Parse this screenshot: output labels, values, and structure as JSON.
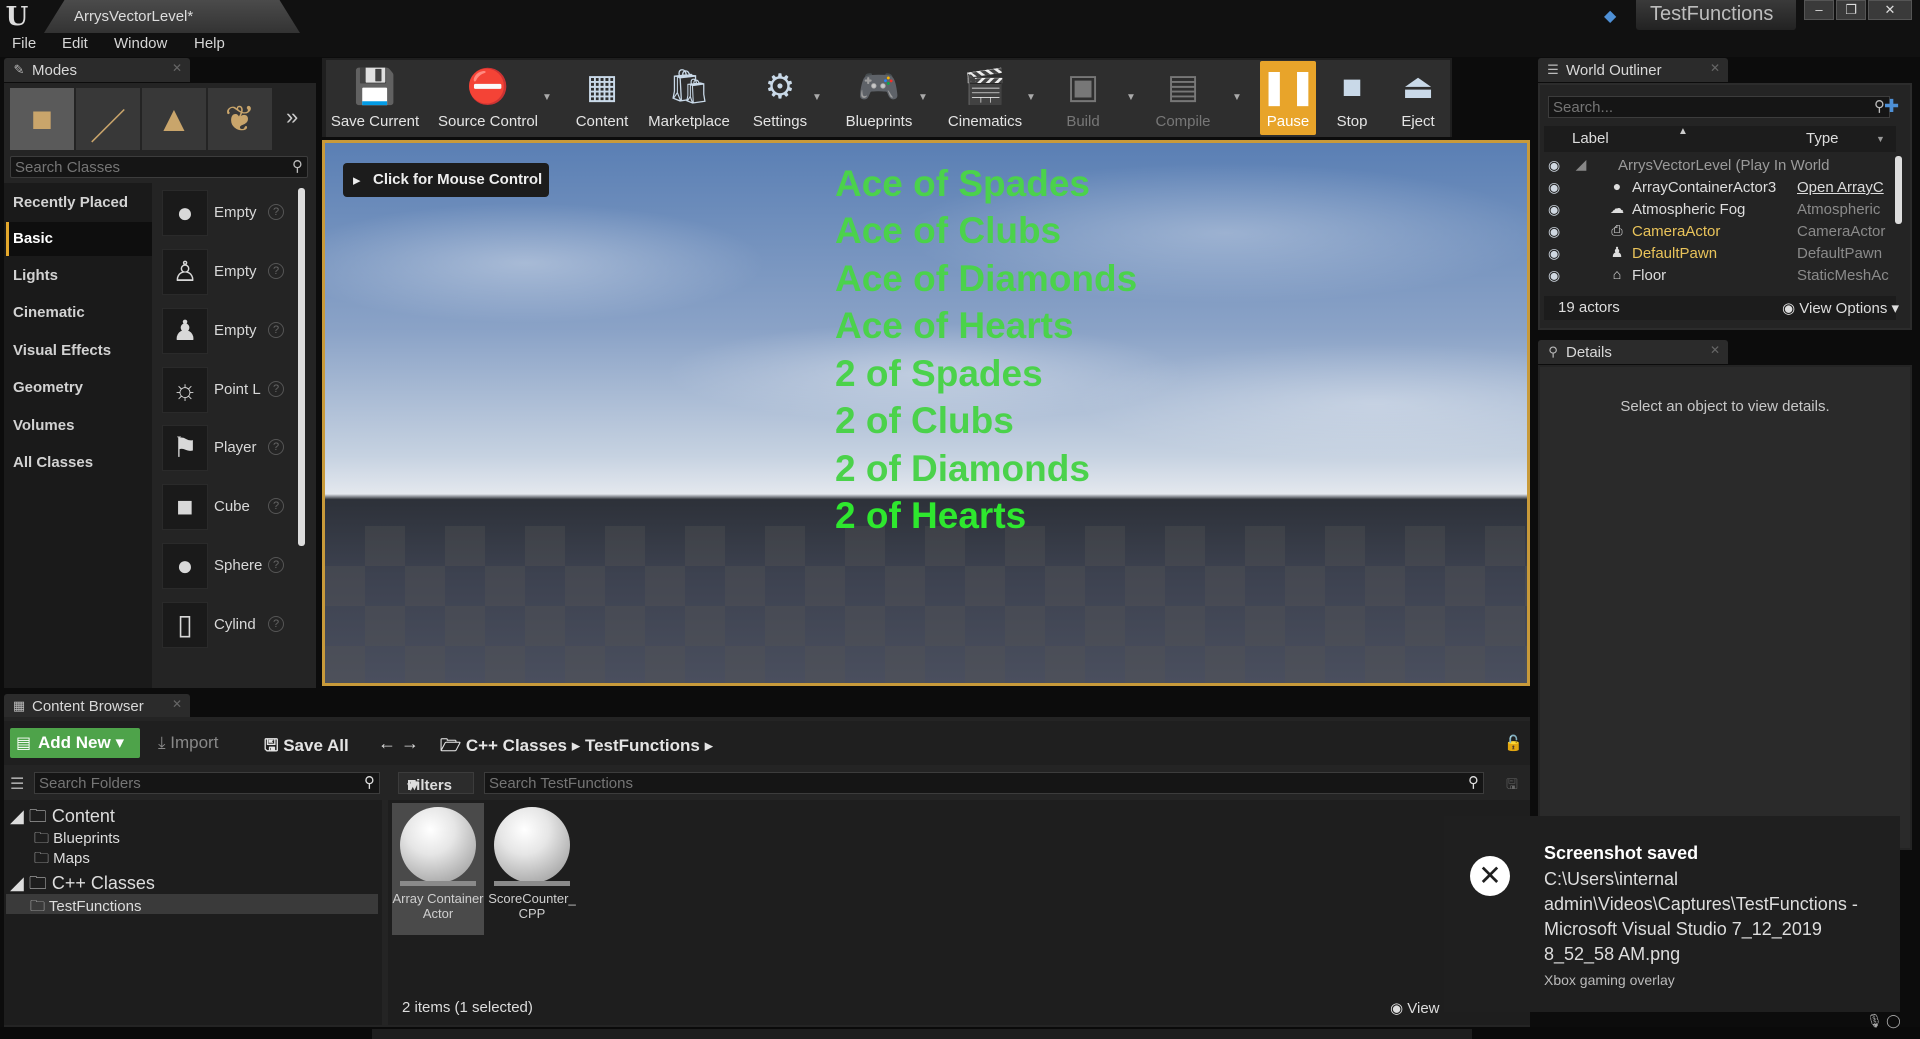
{
  "window": {
    "doc_tab": "ArrysVectorLevel*",
    "project_tab": "TestFunctions",
    "minimize": "–",
    "maximize": "❐",
    "close": "✕"
  },
  "menu": [
    "File",
    "Edit",
    "Window",
    "Help"
  ],
  "modes": {
    "tab_label": "Modes",
    "search_placeholder": "Search Classes",
    "categories": [
      "Recently Placed",
      "Basic",
      "Lights",
      "Cinematic",
      "Visual Effects",
      "Geometry",
      "Volumes",
      "All Classes"
    ],
    "active_category": "Basic",
    "assets": [
      "Empty",
      "Empty",
      "Empty",
      "Point L",
      "Player",
      "Cube",
      "Sphere",
      "Cylind"
    ],
    "help": "?"
  },
  "toolbar": {
    "save_current": "Save Current",
    "source_control": "Source Control",
    "content": "Content",
    "marketplace": "Marketplace",
    "settings": "Settings",
    "blueprints": "Blueprints",
    "cinematics": "Cinematics",
    "build": "Build",
    "compile": "Compile",
    "pause": "Pause",
    "stop": "Stop",
    "eject": "Eject",
    "highlight_color": "#e8a42a"
  },
  "viewport": {
    "mouse_control": "Click for Mouse Control",
    "text_color": "#4bd24b",
    "cards": [
      "Ace of Spades",
      "Ace of Clubs",
      "Ace of Diamonds",
      "Ace of Hearts",
      "2 of Spades",
      "2 of Clubs",
      "2 of Diamonds",
      "2 of Hearts"
    ]
  },
  "world_outliner": {
    "tab_label": "World Outliner",
    "search_placeholder": "Search...",
    "col_label": "Label",
    "col_type": "Type",
    "rows": [
      {
        "label": "ArrysVectorLevel (Play In World",
        "type": ""
      },
      {
        "label": "ArrayContainerActor3",
        "type": "Open ArrayC"
      },
      {
        "label": "Atmospheric Fog",
        "type": "Atmospheric"
      },
      {
        "label": "CameraActor",
        "type": "CameraActor"
      },
      {
        "label": "DefaultPawn",
        "type": "DefaultPawn"
      },
      {
        "label": "Floor",
        "type": "StaticMeshAc"
      }
    ],
    "actor_count": "19 actors",
    "view_options": "View Options"
  },
  "details": {
    "tab_label": "Details",
    "empty_message": "Select an object to view details."
  },
  "content_browser": {
    "tab_label": "Content Browser",
    "add_new": "Add New",
    "import": "Import",
    "save_all": "Save All",
    "path": [
      "C++ Classes",
      "TestFunctions"
    ],
    "folder_search_placeholder": "Search Folders",
    "filters": "Filters",
    "asset_search_placeholder": "Search TestFunctions",
    "tree": {
      "content": "Content",
      "blueprints": "Blueprints",
      "maps": "Maps",
      "cpp_classes": "C++ Classes",
      "test_functions": "TestFunctions"
    },
    "assets": [
      "Array Container Actor",
      "ScoreCounter_ CPP"
    ],
    "status": "2 items (1 selected)",
    "view": "View",
    "accent_color": "#4ea34a"
  },
  "toast": {
    "title": "Screenshot saved",
    "body": "C:\\Users\\internal admin\\Videos\\Captures\\TestFunctions - Microsoft Visual Studio 7_12_2019 8_52_58 AM.png",
    "source": "Xbox gaming overlay"
  }
}
